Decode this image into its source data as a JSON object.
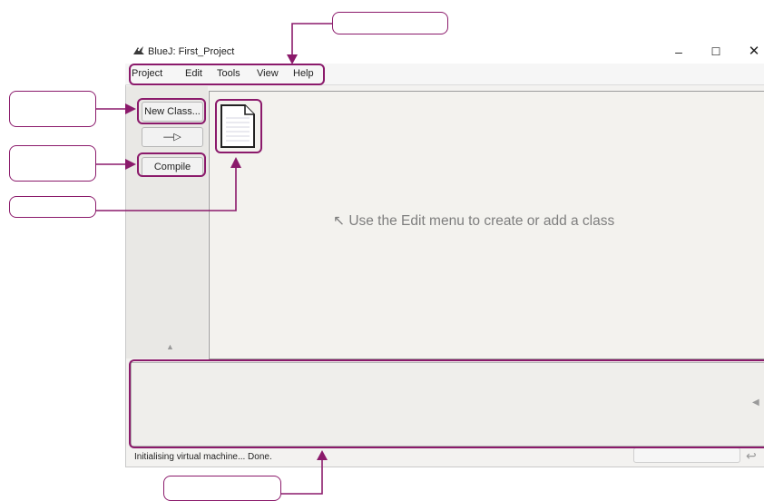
{
  "window": {
    "title": "BlueJ: First_Project",
    "controls": {
      "minimize": "–",
      "maximize": "☐",
      "close": "✕"
    }
  },
  "menu": {
    "items": [
      {
        "label": "Project"
      },
      {
        "label": "Edit"
      },
      {
        "label": "Tools"
      },
      {
        "label": "View"
      },
      {
        "label": "Help"
      }
    ]
  },
  "sidebar": {
    "new_class_label": "New Class...",
    "arrow_label": "—▷",
    "compile_label": "Compile",
    "scroll_up_glyph": "▲"
  },
  "diagram": {
    "hint_arrow": "↖",
    "hint": "Use the Edit menu to create or add a class"
  },
  "output": {
    "scroll_glyph": "◀"
  },
  "status": {
    "text": "Initialising virtual machine... Done.",
    "reset_glyph": "↩"
  },
  "annotations": {
    "color": "#8b1a6b",
    "callout_labels": [
      "",
      "",
      "",
      "",
      ""
    ]
  },
  "icons": {
    "app": "bluej-bird-icon",
    "package": "document-icon"
  }
}
